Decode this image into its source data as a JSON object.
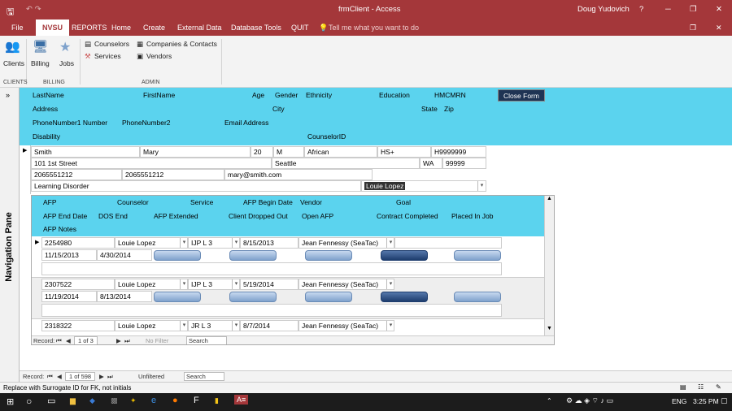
{
  "titlebar": {
    "title": "frmClient - Access",
    "user": "Doug Yudovich",
    "help": "?",
    "minimize": "─",
    "restore": "❐",
    "close": "✕"
  },
  "tabs": [
    "File",
    "NVSU",
    "REPORTS",
    "Home",
    "Create",
    "External Data",
    "Database Tools",
    "QUIT"
  ],
  "tellme": "Tell me what you want to do",
  "ribbon": {
    "clients": "Clients",
    "billing": "Billing",
    "jobs": "Jobs",
    "counselors": "Counselors",
    "companies": "Companies & Contacts",
    "services": "Services",
    "vendors": "Vendors",
    "group_clients": "CLIENTS",
    "group_billing": "BILLING",
    "group_admin": "ADMIN"
  },
  "nav": {
    "label": "Navigation Pane",
    "toggle": "»"
  },
  "header": {
    "lastname": "LastName",
    "firstname": "FirstName",
    "age": "Age",
    "gender": "Gender",
    "ethnicity": "Ethnicity",
    "education": "Education",
    "hmcmrn": "HMCMRN",
    "close_form": "Close Form",
    "address": "Address",
    "city": "City",
    "state": "State",
    "zip": "Zip",
    "phone1": "PhoneNumber1 Number",
    "phone2": "PhoneNumber2",
    "email": "Email Address",
    "disability": "Disability",
    "counselorid": "CounselorID"
  },
  "record": {
    "lastname": "Smith",
    "firstname": "Mary",
    "age": "20",
    "gender": "M",
    "ethnicity": "African",
    "education": "HS+",
    "hmcmrn": "H9999999",
    "address": "101 1st Street",
    "city": "Seattle",
    "state": "WA",
    "zip": "99999",
    "phone1": "2065551212",
    "phone2": "2065551212",
    "email": "mary@smith.com",
    "disability": "Learning Disorder",
    "counselor": "Louie Lopez"
  },
  "subheader": {
    "afp": "AFP",
    "counselor": "Counselor",
    "service": "Service",
    "afp_begin": "AFP Begin Date",
    "vendor": "Vendor",
    "goal": "Goal",
    "afp_end": "AFP End Date",
    "dos_end": "DOS End",
    "afp_extended": "AFP Extended",
    "client_dropped": "Client Dropped Out",
    "open_afp": "Open AFP",
    "contract_completed": "Contract Completed",
    "placed_in_job": "Placed In Job",
    "afp_notes": "AFP Notes"
  },
  "afp_records": [
    {
      "afp": "2254980",
      "counselor": "Louie Lopez",
      "service": "IJP L 3",
      "begin": "8/15/2013",
      "vendor": "Jean Fennessy (SeaTac)",
      "end": "11/15/2013",
      "dos_end": "4/30/2014"
    },
    {
      "afp": "2307522",
      "counselor": "Louie Lopez",
      "service": "IJP L 3",
      "begin": "5/19/2014",
      "vendor": "Jean Fennessy (SeaTac)",
      "end": "11/19/2014",
      "dos_end": "8/13/2014"
    },
    {
      "afp": "2318322",
      "counselor": "Louie Lopez",
      "service": "JR L 3",
      "begin": "8/7/2014",
      "vendor": "Jean Fennessy (SeaTac)"
    }
  ],
  "subnav": {
    "record": "Record:",
    "pos": "1 of 3",
    "nofilter": "No Filter",
    "search": "Search"
  },
  "mainnav": {
    "record": "Record:",
    "pos": "1 of 598",
    "filter": "Unfiltered",
    "search": "Search"
  },
  "status": {
    "text": "Replace with Surrogate ID for FK, not initials"
  },
  "taskbar": {
    "lang": "ENG",
    "time": "3:25 PM"
  },
  "colors": {
    "accent": "#a4373a",
    "header": "#5bd3ee"
  }
}
